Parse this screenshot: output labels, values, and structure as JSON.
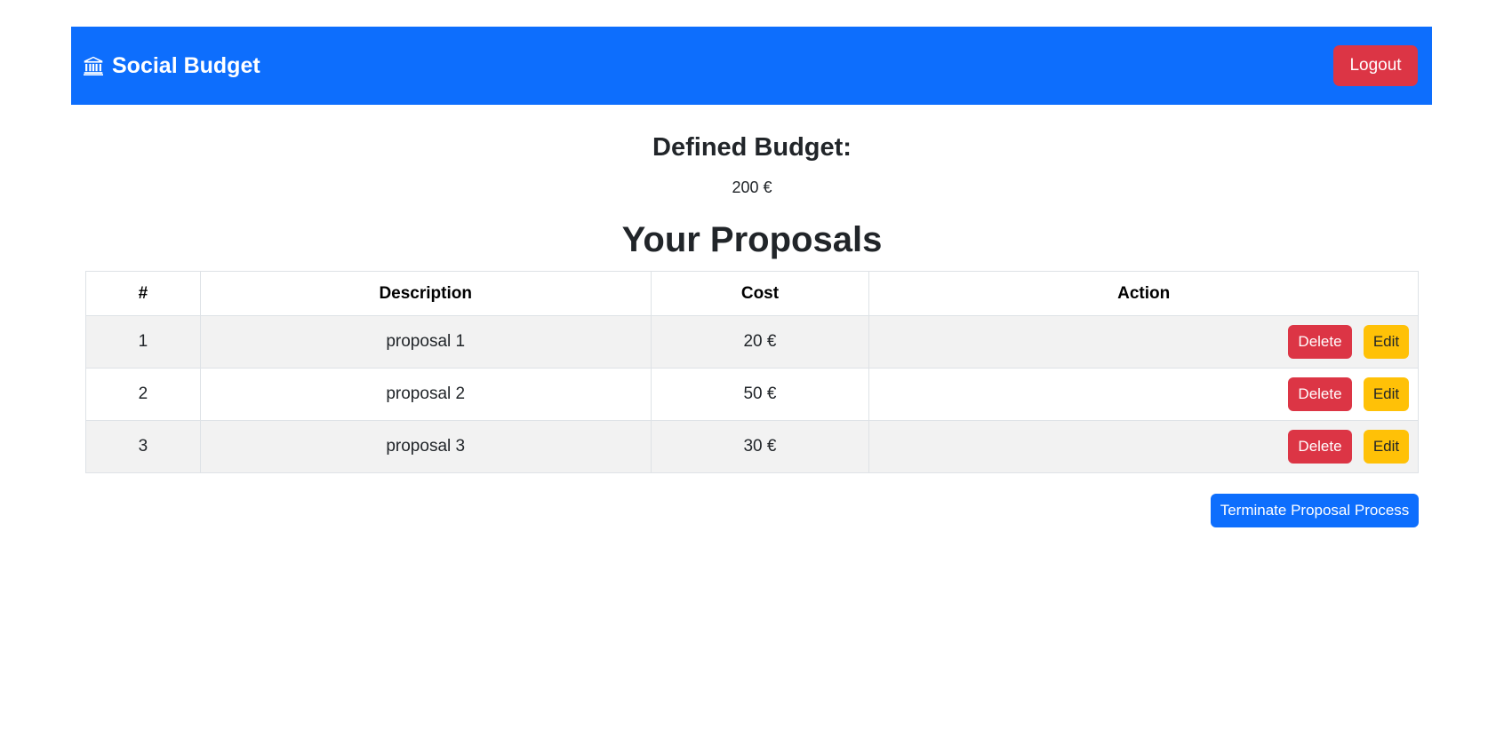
{
  "navbar": {
    "brand": "Social Budget",
    "brand_icon": "bank-icon",
    "logout_label": "Logout",
    "color": "#0d6efd"
  },
  "budget": {
    "title": "Defined Budget:",
    "value": "200 €"
  },
  "proposals": {
    "title": "Your Proposals",
    "columns": [
      "#",
      "Description",
      "Cost",
      "Action"
    ],
    "rows": [
      {
        "num": "1",
        "description": "proposal 1",
        "cost": "20 €",
        "delete_label": "Delete",
        "edit_label": "Edit"
      },
      {
        "num": "2",
        "description": "proposal 2",
        "cost": "50 €",
        "delete_label": "Delete",
        "edit_label": "Edit"
      },
      {
        "num": "3",
        "description": "proposal 3",
        "cost": "30 €",
        "delete_label": "Delete",
        "edit_label": "Edit"
      }
    ]
  },
  "terminate_label": "Terminate Proposal Process",
  "colors": {
    "primary": "#0d6efd",
    "danger": "#dc3545",
    "warning": "#ffc107"
  }
}
